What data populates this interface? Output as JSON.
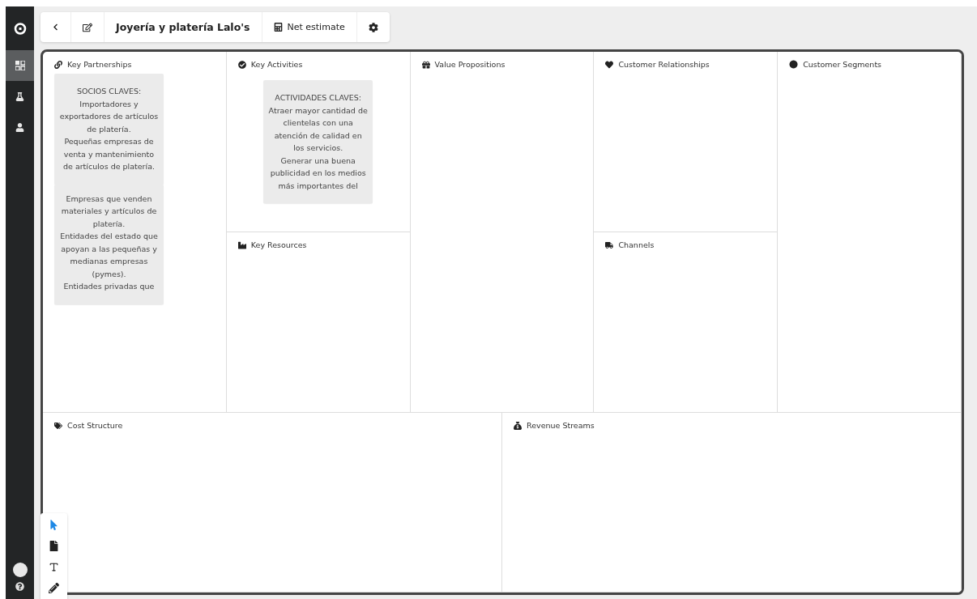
{
  "sidebar": {
    "items": [
      {
        "kind": "grid",
        "selected": true
      },
      {
        "kind": "flask",
        "selected": false
      },
      {
        "kind": "user",
        "selected": false
      }
    ]
  },
  "toolbar": {
    "title": "Joyería y platería Lalo's",
    "estimate": "Net estimate"
  },
  "canvas": {
    "blocks": [
      {
        "kind": "partnerships",
        "title": "Key Partnerships",
        "notes": [
          "SOCIOS CLAVES:\nImportadores y exportadores de artículos de platería.\nPequeñas empresas de venta y mantenimiento de artículos de platería.",
          "Empresas que venden materiales y artículos de platería.\nEntidades del estado que apoyan a las pequeñas y medianas empresas (pymes).\nEntidades privadas que"
        ]
      },
      {
        "kind": "activities",
        "title": "Key Activities",
        "notes": [
          "ACTIVIDADES CLAVES:\nAtraer mayor cantidad de clientelas con una atención de calidad en los servicios.\nGenerar una buena publicidad en los medios más importantes del"
        ]
      },
      {
        "kind": "resources",
        "title": "Key Resources"
      },
      {
        "kind": "propositions",
        "title": "Value Propositions"
      },
      {
        "kind": "relationships",
        "title": "Customer Relationships"
      },
      {
        "kind": "channels",
        "title": "Channels"
      },
      {
        "kind": "segments",
        "title": "Customer Segments"
      },
      {
        "kind": "costs",
        "title": "Cost Structure"
      },
      {
        "kind": "revenue",
        "title": "Revenue Streams"
      }
    ]
  },
  "tools": [
    {
      "kind": "pointer",
      "selected": true
    },
    {
      "kind": "note",
      "selected": false
    },
    {
      "kind": "text",
      "selected": false
    },
    {
      "kind": "pencil",
      "selected": false
    }
  ]
}
